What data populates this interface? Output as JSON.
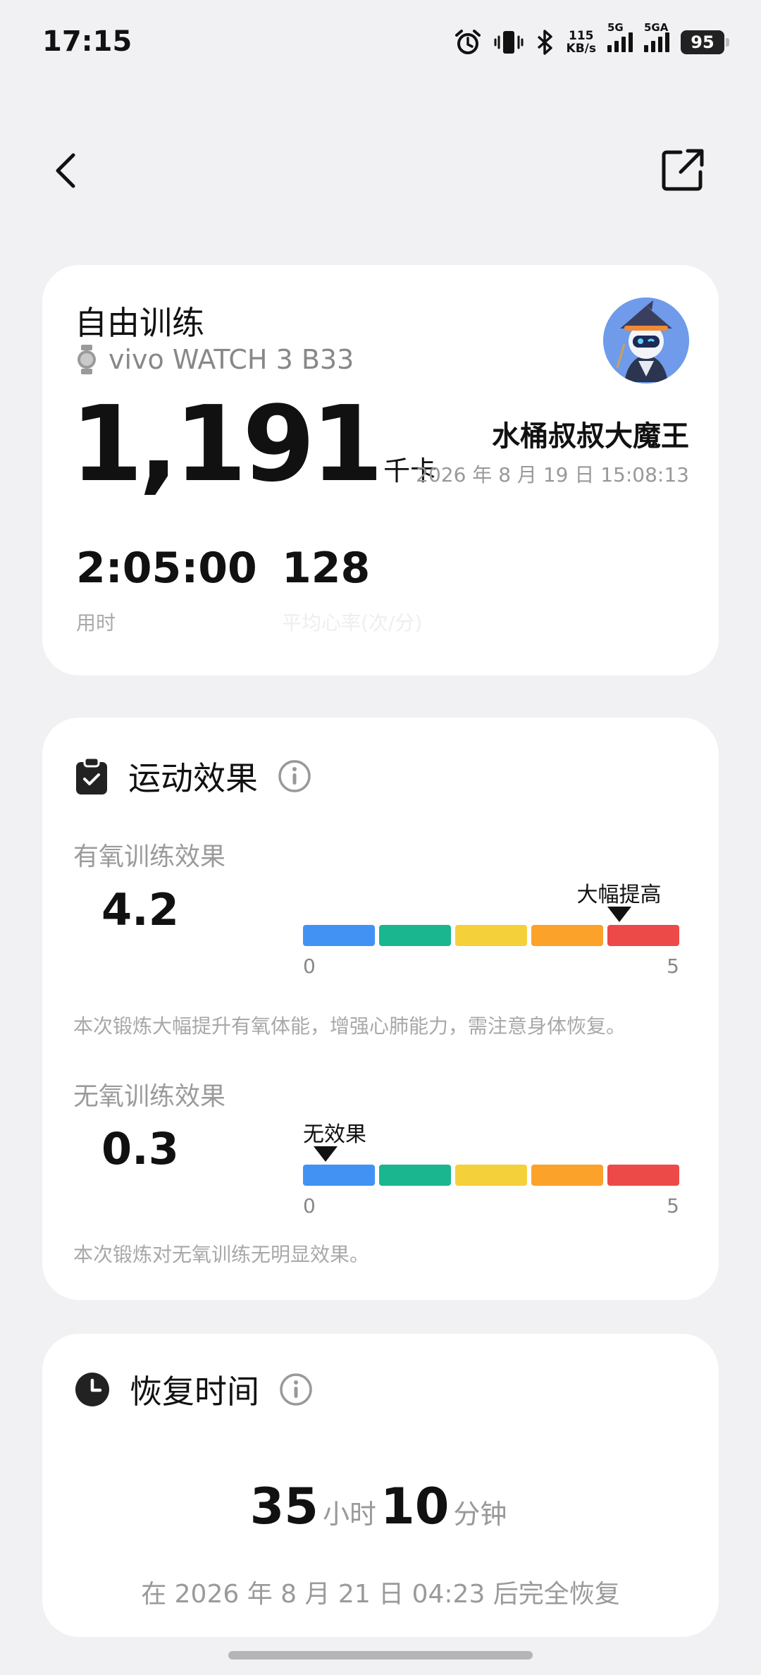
{
  "status_bar": {
    "time": "17:15",
    "net_speed_value": "115",
    "net_speed_unit": "KB/s",
    "sim1_label": "5G",
    "sim2_label": "5GA",
    "battery": "95",
    "icons": [
      "alarm-icon",
      "vibrate-icon",
      "bluetooth-icon"
    ]
  },
  "nav": {
    "back_icon": "chevron-left-icon",
    "share_icon": "open-external-icon"
  },
  "workout": {
    "title": "自由训练",
    "device": "vivo WATCH 3 B33",
    "calories": "1,191",
    "calories_unit": "千卡",
    "username": "水桶叔叔大魔王",
    "datetime": "2026 年 8 月 19 日 15:08:13",
    "duration": "2:05:00",
    "duration_label": "用时",
    "heart_rate": "128",
    "heart_rate_label": "平均心率(次/分)"
  },
  "effect": {
    "title": "运动效果",
    "aerobic": {
      "label": "有氧训练效果",
      "value": "4.2",
      "level": 4.2,
      "level_text": "大幅提高",
      "scale_min": "0",
      "scale_max": "5",
      "description": "本次锻炼大幅提升有氧体能，增强心肺能力，需注意身体恢复。"
    },
    "anaerobic": {
      "label": "无氧训练效果",
      "value": "0.3",
      "level": 0.3,
      "level_text": "无效果",
      "scale_min": "0",
      "scale_max": "5",
      "description": "本次锻炼对无氧训练无明显效果。"
    },
    "scale_colors": [
      "#4292f4",
      "#19b68f",
      "#f4d03a",
      "#fba22b",
      "#ec4a48"
    ]
  },
  "recovery": {
    "title": "恢复时间",
    "hours": "35",
    "hours_unit": "小时",
    "minutes": "10",
    "minutes_unit": "分钟",
    "description": "在 2026 年 8 月 21 日 04:23 后完全恢复"
  }
}
